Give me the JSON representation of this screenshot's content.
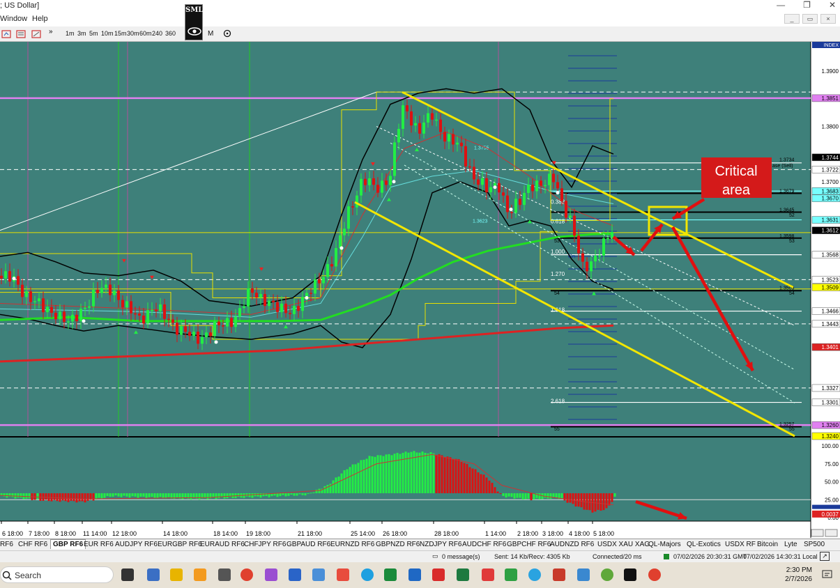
{
  "window": {
    "title": "; US Dollar]",
    "controls": [
      "—",
      "❐",
      "✕"
    ]
  },
  "menu": [
    "Window",
    "Help"
  ],
  "toolbar": {
    "timeframes": [
      "1m",
      "3m",
      "5m",
      "10m",
      "15m",
      "30m",
      "60m",
      "240",
      "360"
    ],
    "logo_text": "SMLR",
    "m_label": "M"
  },
  "chart": {
    "symbol_badge": "INDEX",
    "annotation_text_1": "Critical",
    "annotation_text_2": "area",
    "price_scale": [
      "1.3900",
      "1.3851",
      "1.3800",
      "1.3744",
      "1.3722",
      "1.3700",
      "1.3683",
      "1.3670",
      "1.3631",
      "1.3612",
      "1.3568",
      "1.3523",
      "1.3509",
      "1.3466",
      "1.3443",
      "1.3401",
      "1.3327",
      "1.3301",
      "1.3260",
      "1.3240"
    ],
    "fib_labels": [
      "0.382",
      "0.618",
      "1.000",
      "1.270",
      "1.618",
      "2.618"
    ],
    "level_labels": [
      "1.3734",
      "1.3679",
      "1.3645",
      "1.3598",
      "1.3503",
      "1.3257",
      "1.3755",
      "1.3623"
    ],
    "zone_text": "ase (Sell)",
    "small_labels": [
      "52",
      "53",
      "54",
      "55",
      "Cn"
    ],
    "osc_scale": [
      "100.00",
      "75.00",
      "50.00",
      "25.00",
      "0.00"
    ],
    "osc_value": "0.0037",
    "time_axis": [
      "6 18:00",
      "7 18:00",
      "8 18:00",
      "11 14:00",
      "12 18:00",
      "14 18:00",
      "18 14:00",
      "19 18:00",
      "21 18:00",
      "25 14:00",
      "26 18:00",
      "28 18:00",
      "1 14:00",
      "2 18:00",
      "3 18:00",
      "4 18:00",
      "5 18:00"
    ],
    "colors": {
      "background": "#3e807a",
      "channel": "#f2e600",
      "arrow": "#e01010",
      "critical_box": "#d41a1a",
      "support_magenta": "#e080f0",
      "ma_green": "#22dd22",
      "ma_red": "#dd2222",
      "bull": "#22ee44",
      "bear": "#dd1111"
    }
  },
  "tabs": [
    "RF6",
    "CHF RF6",
    "GBP RF6",
    "EUR RF6",
    "AUDJPY RF6",
    "EURGBP RF6",
    "EURAUD RF6",
    "CHFJPY RF6",
    "GBPAUD RF6",
    "EURNZD RF6",
    "GBPNZD RF6",
    "NZDJPY RF6",
    "AUDCHF RF6",
    "GBPCHF RF6",
    "AUDNZD RF6",
    "USDX XAU XAG",
    "QL-Majors",
    "QL-Exotics",
    "USDX RF",
    "Bitcoin",
    "Lyte",
    "SP500"
  ],
  "active_tab": "GBP RF6",
  "status": {
    "messages": "0 message(s)",
    "traffic": "Sent: 14 Kb/Recv: 4305 Kb",
    "connection": "Connected/20 ms",
    "gmt": "07/02/2026 20:30:31 GMT",
    "local": "07/02/2026 14:30:31 Local"
  },
  "taskbar": {
    "search_label": "Search",
    "time": "2:30 PM",
    "date": "2/7/2026"
  }
}
